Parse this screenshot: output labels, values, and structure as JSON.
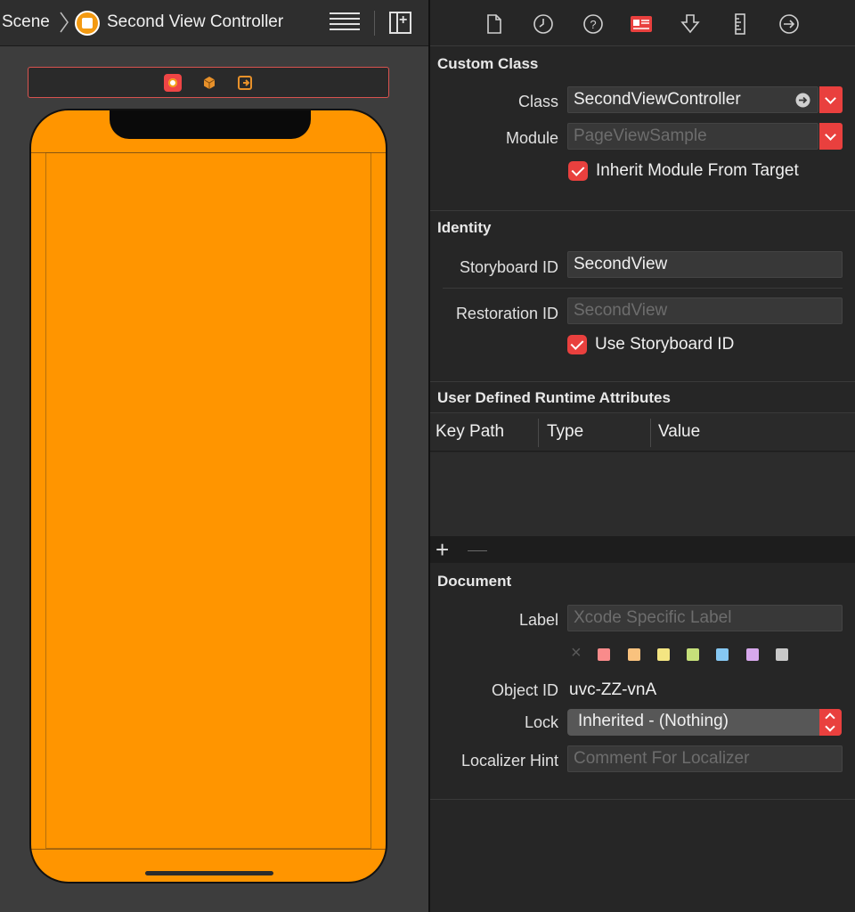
{
  "jumpbar": {
    "scene_label": "Scene",
    "controller_label": "Second View Controller"
  },
  "inspector": {
    "tabs": [
      "file-icon",
      "history-icon",
      "help-icon",
      "identity-icon",
      "attributes-icon",
      "size-icon",
      "connections-icon"
    ],
    "custom_class": {
      "title": "Custom Class",
      "class_label": "Class",
      "class_value": "SecondViewController",
      "module_label": "Module",
      "module_placeholder": "PageViewSample",
      "inherit_label": "Inherit Module From Target"
    },
    "identity": {
      "title": "Identity",
      "storyboard_id_label": "Storyboard ID",
      "storyboard_id_value": "SecondView",
      "restoration_id_label": "Restoration ID",
      "restoration_id_placeholder": "SecondView",
      "use_storyboard_label": "Use Storyboard ID"
    },
    "runtime_attributes": {
      "title": "User Defined Runtime Attributes",
      "columns": [
        "Key Path",
        "Type",
        "Value"
      ]
    },
    "document": {
      "title": "Document",
      "label_label": "Label",
      "label_placeholder": "Xcode Specific Label",
      "swatch_colors": [
        "#f98b8b",
        "#f9c27e",
        "#f4e582",
        "#c6e07a",
        "#86c8f3",
        "#d7a8ec",
        "#c9c9c9"
      ],
      "object_id_label": "Object ID",
      "object_id_value": "uvc-ZZ-vnA",
      "lock_label": "Lock",
      "lock_value": "Inherited - (Nothing)",
      "localizer_label": "Localizer Hint",
      "localizer_placeholder": "Comment For Localizer"
    }
  },
  "colors": {
    "accent": "#e9403e",
    "view_background": "#ff9500"
  }
}
